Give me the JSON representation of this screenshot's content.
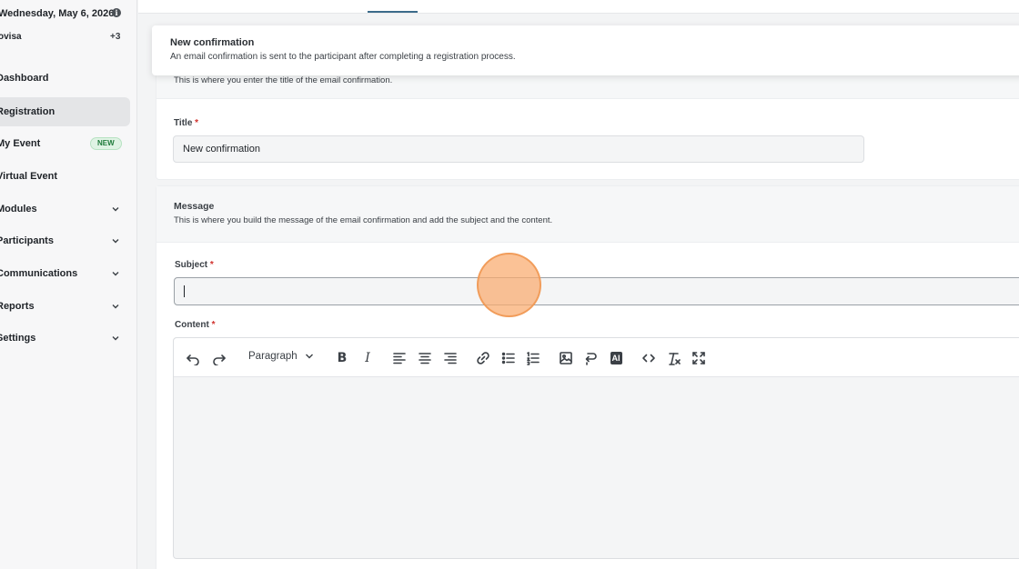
{
  "sidebar": {
    "date": "Wednesday, May 6, 2026",
    "org_name": "ovisa",
    "org_extra": "+3",
    "items": [
      {
        "label": "Dashboard"
      },
      {
        "label": "Registration",
        "active": true
      },
      {
        "label": "My Event",
        "badge": "NEW"
      },
      {
        "label": "Virtual Event"
      },
      {
        "label": "Modules",
        "expandable": true
      },
      {
        "label": "Participants",
        "expandable": true
      },
      {
        "label": "Communications",
        "expandable": true
      },
      {
        "label": "Reports",
        "expandable": true
      },
      {
        "label": "Settings",
        "expandable": true
      }
    ]
  },
  "banner": {
    "title": "New confirmation",
    "description": "An email confirmation is sent to the participant after completing a registration process."
  },
  "title_section": {
    "description_partial": "This is where you enter the title of the email confirmation.",
    "field_label": "Title",
    "required_mark": "*",
    "value": "New confirmation"
  },
  "message_section": {
    "title": "Message",
    "description": "This is where you build the message of the email confirmation and add the subject and the content.",
    "subject_label": "Subject",
    "subject_value": "",
    "content_label": "Content",
    "required_mark": "*"
  },
  "editor": {
    "block_format": "Paragraph",
    "ai_label": "AI",
    "icons": [
      "undo-icon",
      "redo-icon",
      "bold-icon",
      "italic-icon",
      "align-left-icon",
      "align-center-icon",
      "align-right-icon",
      "link-icon",
      "bullet-list-icon",
      "numbered-list-icon",
      "image-icon",
      "embed-icon",
      "ai-icon",
      "code-icon",
      "clear-format-icon",
      "fullscreen-icon"
    ]
  },
  "colors": {
    "accent_tab": "#3b6b8a",
    "required": "#d0312d",
    "badge_bg": "#dff3e4",
    "badge_text": "#1e7a3a",
    "cursor": "#faaa6e"
  }
}
